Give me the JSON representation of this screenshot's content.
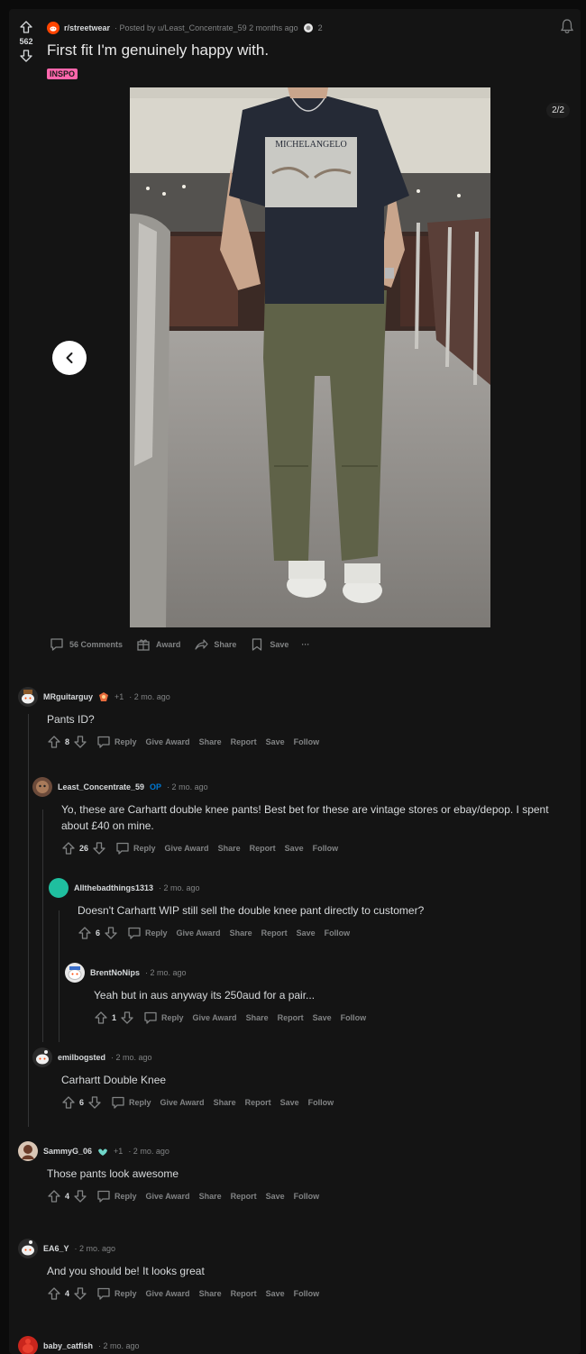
{
  "post": {
    "vote_count": "562",
    "subreddit": "r/streetwear",
    "posted_by": "· Posted by u/Least_Concentrate_59 2 months ago",
    "title": "First fit I'm genuinely happy with.",
    "flair": "INSPO",
    "gallery_counter": "2/2",
    "shirt_print_text": "MICHELANGELO"
  },
  "action_bar": {
    "comments": "56 Comments",
    "award": "Award",
    "share": "Share",
    "save": "Save",
    "more": "···"
  },
  "comment_actions": {
    "reply": "Reply",
    "give_award": "Give Award",
    "share": "Share",
    "report": "Report",
    "save": "Save",
    "follow": "Follow"
  },
  "comments": [
    {
      "user": "MRguitarguy",
      "extra": "+1",
      "time": "· 2 mo. ago",
      "body": "Pants ID?",
      "votes": "8"
    },
    {
      "user": "Least_Concentrate_59",
      "op": "OP",
      "time": "· 2 mo. ago",
      "body": "Yo, these are Carhartt double knee pants! Best bet for these are vintage stores or ebay/depop. I spent about £40 on mine.",
      "votes": "26"
    },
    {
      "user": "Allthebadthings1313",
      "time": "· 2 mo. ago",
      "body": "Doesn't Carhartt WIP still sell the double knee pant directly to customer?",
      "votes": "6"
    },
    {
      "user": "BrentNoNips",
      "time": "· 2 mo. ago",
      "body": "Yeah but in aus anyway its 250aud for a pair...",
      "votes": "1"
    },
    {
      "user": "emilbogsted",
      "time": "· 2 mo. ago",
      "body": "Carhartt Double Knee",
      "votes": "6"
    },
    {
      "user": "SammyG_06",
      "extra": "+1",
      "time": "· 2 mo. ago",
      "body": "Those pants look awesome",
      "votes": "4"
    },
    {
      "user": "EA6_Y",
      "time": "· 2 mo. ago",
      "body": "And you should be! It looks great",
      "votes": "4"
    },
    {
      "user": "baby_catfish",
      "time": "· 2 mo. ago"
    }
  ],
  "colors": {
    "accent_upvote": "#ff4500",
    "flair": "#ff66ac",
    "op": "#0079d3",
    "muted": "#818384"
  }
}
